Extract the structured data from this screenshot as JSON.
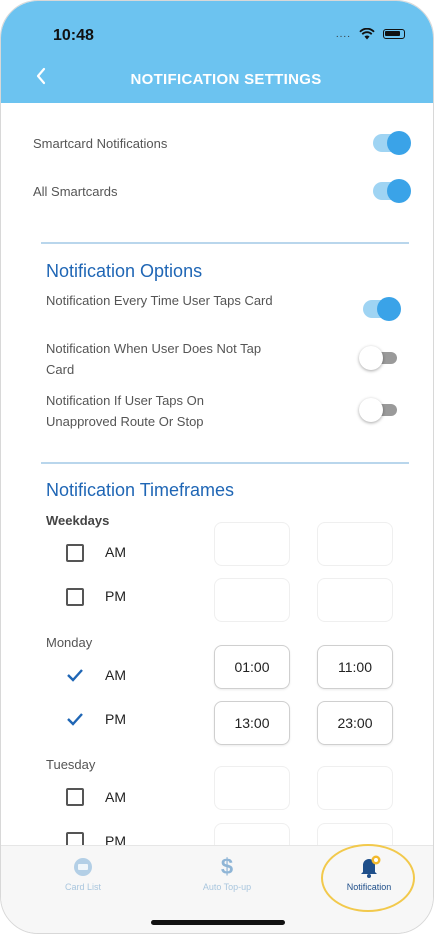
{
  "status": {
    "time": "10:48",
    "signal": "...."
  },
  "header": {
    "title": "NOTIFICATION SETTINGS",
    "back_icon": "chevron-left-icon"
  },
  "general": [
    {
      "label": "Smartcard Notifications",
      "on": true
    },
    {
      "label": "All Smartcards",
      "on": true
    }
  ],
  "options": {
    "title": "Notification Options",
    "items": [
      {
        "label_line1": "Notification Every Time User Taps Card",
        "label_line2": "",
        "on": true
      },
      {
        "label_line1": "Notification When User Does Not Tap",
        "label_line2": "Card",
        "on": false
      },
      {
        "label_line1": "Notification If User Taps On",
        "label_line2": "Unapproved Route Or Stop",
        "on": false
      }
    ]
  },
  "timeframes": {
    "title": "Notification Timeframes",
    "groups": [
      {
        "name": "Weekdays",
        "rows": [
          {
            "period": "AM",
            "checked": false,
            "from": "",
            "to": ""
          },
          {
            "period": "PM",
            "checked": false,
            "from": "",
            "to": ""
          }
        ]
      },
      {
        "name": "Monday",
        "rows": [
          {
            "period": "AM",
            "checked": true,
            "from": "01:00",
            "to": "11:00"
          },
          {
            "period": "PM",
            "checked": true,
            "from": "13:00",
            "to": "23:00"
          }
        ]
      },
      {
        "name": "Tuesday",
        "rows": [
          {
            "period": "AM",
            "checked": false,
            "from": "",
            "to": ""
          },
          {
            "period": "PM",
            "checked": false,
            "from": "",
            "to": ""
          }
        ]
      }
    ]
  },
  "tabs": [
    {
      "label": "Card List",
      "icon": "card-icon",
      "active": false
    },
    {
      "label": "Auto Top-up",
      "icon": "dollar-icon",
      "active": false
    },
    {
      "label": "Notification",
      "icon": "bell-icon",
      "active": true
    }
  ],
  "colors": {
    "header": "#6cc3f0",
    "accent": "#3aa3e8",
    "section_title": "#1f66b5",
    "highlight": "#f2c94c"
  }
}
